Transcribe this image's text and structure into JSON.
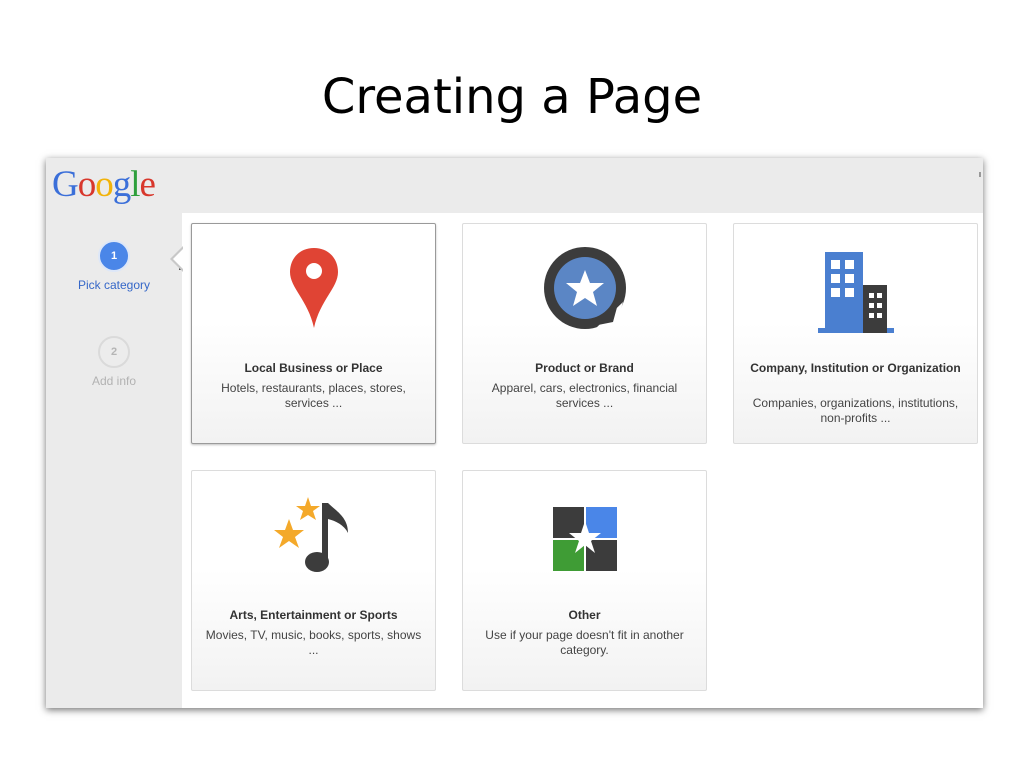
{
  "slide": {
    "title": "Creating a Page"
  },
  "header": {
    "logo_text": "Google"
  },
  "steps": [
    {
      "number": "1",
      "label": "Pick category",
      "state": "active"
    },
    {
      "number": "2",
      "label": "Add info",
      "state": "inactive"
    }
  ],
  "categories": [
    {
      "title": "Local Business or Place",
      "description": "Hotels, restaurants, places, stores, services ...",
      "icon": "map-pin-icon",
      "selected": true
    },
    {
      "title": "Product or Brand",
      "description": "Apparel, cars, electronics, financial services ...",
      "icon": "star-sticker-icon",
      "selected": false
    },
    {
      "title": "Company, Institution or Organization",
      "description": "Companies, organizations, institutions, non-profits ...",
      "icon": "buildings-icon",
      "selected": false
    },
    {
      "title": "Arts, Entertainment or Sports",
      "description": "Movies, TV, music, books, sports, shows ...",
      "icon": "music-stars-icon",
      "selected": false
    },
    {
      "title": "Other",
      "description": "Use if your page doesn't fit in another category.",
      "icon": "puzzle-icon",
      "selected": false
    }
  ],
  "colors": {
    "accent_blue": "#4a86e8",
    "pin_red": "#e04434",
    "dark_gray": "#3c3c3c",
    "star_orange": "#f4a92a",
    "green": "#3f9c35"
  }
}
